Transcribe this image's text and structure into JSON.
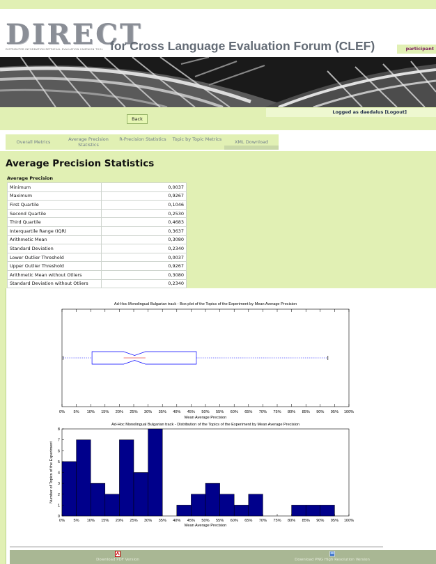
{
  "header": {
    "logo_text": "DIRECT",
    "logo_subtitle": "DISTRIBUTED INFORMATION RETRIEVAL EVALUATION CAMPAIGN TOOL",
    "title": "for Cross Language Evaluation Forum (CLEF)",
    "role": "participant"
  },
  "nav": {
    "back_label": "Back",
    "login_text": "Logged as daedalus [Logout]"
  },
  "tabs": [
    {
      "label": "Overall Metrics",
      "active": false
    },
    {
      "label": "Average Precision Statistics",
      "active": true
    },
    {
      "label": "R-Precision Statistics",
      "active": false
    },
    {
      "label": "Topic by Topic Metrics",
      "active": false
    },
    {
      "label": "XML Download",
      "active": false
    }
  ],
  "page": {
    "title": "Average Precision Statistics"
  },
  "stats": {
    "title": "Average Precision",
    "rows": [
      {
        "label": "Minimum",
        "value": "0,0037"
      },
      {
        "label": "Maximum",
        "value": "0,9267"
      },
      {
        "label": "First Quartile",
        "value": "0,1046"
      },
      {
        "label": "Second Quartile",
        "value": "0,2530"
      },
      {
        "label": "Third Quartile",
        "value": "0,4683"
      },
      {
        "label": "Interquartile Range (IQR)",
        "value": "0,3637"
      },
      {
        "label": "Arithmetic Mean",
        "value": "0,3080"
      },
      {
        "label": "Standard Deviation",
        "value": "0,2340"
      },
      {
        "label": "Lower Outlier Threshold",
        "value": "0,0037"
      },
      {
        "label": "Upper Outlier Threshold",
        "value": "0,9267"
      },
      {
        "label": "Arithmetic Mean without Otliers",
        "value": "0,3080"
      },
      {
        "label": "Standard Deviation without Otliers",
        "value": "0,2340"
      }
    ]
  },
  "chart_data": [
    {
      "type": "box",
      "title": "Ad-Hoc Monolingual Bulgarian track - Box plot of the Topics of the Experiment by Mean Average Precision",
      "xlabel": "Mean Average Precision",
      "ylabel": "",
      "xlim": [
        0,
        100
      ],
      "x_ticks": [
        "0%",
        "5%",
        "10%",
        "15%",
        "20%",
        "25%",
        "30%",
        "35%",
        "40%",
        "45%",
        "50%",
        "55%",
        "60%",
        "65%",
        "70%",
        "75%",
        "80%",
        "85%",
        "90%",
        "95%",
        "100%"
      ],
      "whisker_low": 0.37,
      "q1": 10.46,
      "median": 25.3,
      "q3": 46.83,
      "whisker_high": 92.67,
      "notch_low": 21.5,
      "notch_high": 29.1,
      "grid": false
    },
    {
      "type": "bar",
      "title": "Ad-Hoc Monolingual Bulgarian track - Distribution of the Topics of the Experiment by Mean Average Precision",
      "xlabel": "Mean Average Precision",
      "ylabel": "Number of Topics of the Experiment",
      "x_ticks": [
        "0%",
        "5%",
        "10%",
        "15%",
        "20%",
        "25%",
        "30%",
        "35%",
        "40%",
        "45%",
        "50%",
        "55%",
        "60%",
        "65%",
        "70%",
        "75%",
        "80%",
        "85%",
        "90%",
        "95%",
        "100%"
      ],
      "y_ticks": [
        0,
        1,
        2,
        3,
        4,
        5,
        6,
        7,
        8
      ],
      "ylim": [
        0,
        8
      ],
      "bins": [
        {
          "start": 0,
          "end": 5,
          "count": 5
        },
        {
          "start": 5,
          "end": 10,
          "count": 7
        },
        {
          "start": 10,
          "end": 15,
          "count": 3
        },
        {
          "start": 15,
          "end": 20,
          "count": 2
        },
        {
          "start": 20,
          "end": 25,
          "count": 7
        },
        {
          "start": 25,
          "end": 30,
          "count": 4
        },
        {
          "start": 30,
          "end": 35,
          "count": 8
        },
        {
          "start": 35,
          "end": 40,
          "count": 0
        },
        {
          "start": 40,
          "end": 45,
          "count": 1
        },
        {
          "start": 45,
          "end": 50,
          "count": 2
        },
        {
          "start": 50,
          "end": 55,
          "count": 3
        },
        {
          "start": 55,
          "end": 60,
          "count": 2
        },
        {
          "start": 60,
          "end": 65,
          "count": 1
        },
        {
          "start": 65,
          "end": 70,
          "count": 2
        },
        {
          "start": 70,
          "end": 75,
          "count": 0
        },
        {
          "start": 75,
          "end": 80,
          "count": 0
        },
        {
          "start": 80,
          "end": 85,
          "count": 1
        },
        {
          "start": 85,
          "end": 90,
          "count": 1
        },
        {
          "start": 90,
          "end": 95,
          "count": 1
        },
        {
          "start": 95,
          "end": 100,
          "count": 0
        }
      ],
      "bar_color": "#00008b",
      "grid": false
    }
  ],
  "footer": {
    "pdf_label": "Download PDF Version",
    "png_label": "Download PNG High Resolution Version"
  },
  "colors": {
    "accent": "#e1f0b4",
    "button_bg": "#a9b794",
    "bar": "#00008b",
    "box": "#0000ff"
  }
}
